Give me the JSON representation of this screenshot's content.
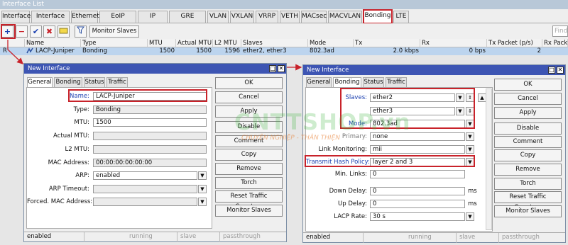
{
  "window_title": "Interface List",
  "main_tabs": [
    "Interface",
    "Interface List",
    "Ethernet",
    "EoIP Tunnel",
    "IP Tunnel",
    "GRE Tunnel",
    "VLAN",
    "VXLAN",
    "VRRP",
    "VETH",
    "MACsec",
    "MACVLAN",
    "Bonding",
    "LTE"
  ],
  "toolbar": {
    "monitor_slaves": "Monitor Slaves",
    "find_placeholder": "Find"
  },
  "columns": [
    "Name",
    "Type",
    "MTU",
    "Actual MTU",
    "L2 MTU",
    "Slaves",
    "Mode",
    "Tx",
    "Rx",
    "Tx Packet (p/s)",
    "Rx Packe"
  ],
  "row": {
    "flag": "R",
    "name": "LACP-Juniper",
    "type": "Bonding",
    "mtu": "1500",
    "actual_mtu": "1500",
    "l2_mtu": "1596",
    "slaves": "ether2, ether3",
    "mode": "802.3ad",
    "tx": "2.0 kbps",
    "rx": "0 bps",
    "tx_packet": "2",
    "rx_packet": ""
  },
  "left_win": {
    "title": "New Interface",
    "tabs": [
      "General",
      "Bonding",
      "Status",
      "Traffic"
    ],
    "fields": [
      {
        "label": "Name:",
        "value": "LACP-Juniper"
      },
      {
        "label": "Type:",
        "value": "Bonding"
      },
      {
        "label": "MTU:",
        "value": "1500"
      },
      {
        "label": "Actual MTU:",
        "value": ""
      },
      {
        "label": "L2 MTU:",
        "value": ""
      },
      {
        "label": "MAC Address:",
        "value": "00:00:00:00:00:00"
      },
      {
        "label": "ARP:",
        "value": "enabled"
      },
      {
        "label": "ARP Timeout:",
        "value": ""
      },
      {
        "label": "Forced. MAC Address:",
        "value": ""
      }
    ],
    "status": [
      "enabled",
      "running",
      "slave",
      "passthrough"
    ]
  },
  "right_win": {
    "title": "New Interface",
    "tabs": [
      "General",
      "Bonding",
      "Status",
      "Traffic"
    ],
    "fields": [
      {
        "label": "Slaves:",
        "value": "ether2"
      },
      {
        "label": "",
        "value": "ether3"
      },
      {
        "label": "Mode:",
        "value": "802.3ad"
      },
      {
        "label": "Primary:",
        "value": "none"
      },
      {
        "label": "Link Monitoring:",
        "value": "mii"
      },
      {
        "label": "Transmit Hash Policy:",
        "value": "layer 2 and 3"
      },
      {
        "label": "Min. Links:",
        "value": "0"
      },
      {
        "label": "Down Delay:",
        "value": "0",
        "unit": "ms"
      },
      {
        "label": "Up Delay:",
        "value": "0",
        "unit": "ms"
      },
      {
        "label": "LACP Rate:",
        "value": "30 s"
      }
    ],
    "status": [
      "enabled",
      "running",
      "slave",
      "passthrough"
    ]
  },
  "actions": [
    "OK",
    "Cancel",
    "Apply",
    "Disable",
    "Comment",
    "Copy",
    "Remove",
    "Torch",
    "Reset Traffic Counters",
    "Monitor Slaves"
  ],
  "watermark": {
    "brand": "CNTTSHOP.vn",
    "tagline": "CHUYÊN NGHIỆP - THÂN THIỆN"
  },
  "colors": {
    "highlight": "#c8222a",
    "title_bar": "#3d55b3",
    "selected_row": "#bcd4ee",
    "label_blue": "#1a3fb0"
  }
}
